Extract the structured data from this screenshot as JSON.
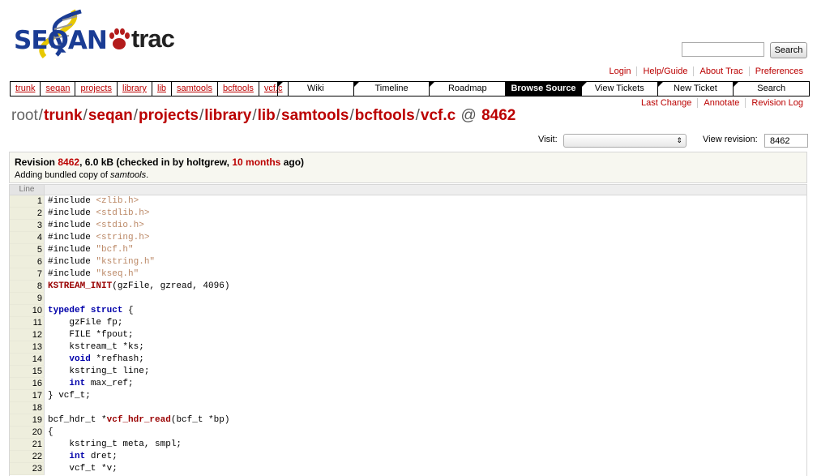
{
  "logo": {
    "left": "SEQAN",
    "right": "trac"
  },
  "search": {
    "placeholder": "",
    "button": "Search"
  },
  "metanav": [
    "Login",
    "Help/Guide",
    "About Trac",
    "Preferences"
  ],
  "pathnav": [
    "trunk",
    "seqan",
    "projects",
    "library",
    "lib",
    "samtools",
    "bcftools",
    "vcf.c"
  ],
  "mainnav": [
    "Wiki",
    "Timeline",
    "Roadmap",
    "Browse Source",
    "View Tickets",
    "New Ticket",
    "Search"
  ],
  "mainnav_active": "Browse Source",
  "ctxtnav": [
    "Last Change",
    "Annotate",
    "Revision Log"
  ],
  "path_title": {
    "root": "root",
    "segments": [
      "trunk",
      "seqan",
      "projects",
      "library",
      "lib",
      "samtools",
      "bcftools",
      "vcf.c"
    ],
    "at": "@",
    "revision": "8462"
  },
  "visit": {
    "label": "Visit:",
    "value": ""
  },
  "view_revision": {
    "label": "View revision:",
    "value": "8462"
  },
  "info": {
    "revision_prefix": "Revision ",
    "revision": "8462",
    "size_and_author": ", 6.0 kB (checked in by holtgrew, ",
    "age": "10 months",
    "suffix": " ago)",
    "message_prefix": "Adding bundled copy of ",
    "message_em": "samtools",
    "message_suffix": "."
  },
  "code": {
    "header": "Line",
    "lines": [
      [
        {
          "t": "#include ",
          "c": "pp"
        },
        {
          "t": "<zlib.h>",
          "c": "str"
        }
      ],
      [
        {
          "t": "#include ",
          "c": "pp"
        },
        {
          "t": "<stdlib.h>",
          "c": "str"
        }
      ],
      [
        {
          "t": "#include ",
          "c": "pp"
        },
        {
          "t": "<stdio.h>",
          "c": "str"
        }
      ],
      [
        {
          "t": "#include ",
          "c": "pp"
        },
        {
          "t": "<string.h>",
          "c": "str"
        }
      ],
      [
        {
          "t": "#include ",
          "c": "pp"
        },
        {
          "t": "\"bcf.h\"",
          "c": "str"
        }
      ],
      [
        {
          "t": "#include ",
          "c": "pp"
        },
        {
          "t": "\"kstring.h\"",
          "c": "str"
        }
      ],
      [
        {
          "t": "#include ",
          "c": "pp"
        },
        {
          "t": "\"kseq.h\"",
          "c": "str"
        }
      ],
      [
        {
          "t": "KSTREAM_INIT",
          "c": "fn"
        },
        {
          "t": "(gzFile, gzread, 4096)",
          "c": ""
        }
      ],
      [],
      [
        {
          "t": "typedef",
          "c": "kw"
        },
        {
          "t": " ",
          "c": ""
        },
        {
          "t": "struct",
          "c": "kw"
        },
        {
          "t": " {",
          "c": ""
        }
      ],
      [
        {
          "t": "    gzFile fp;",
          "c": ""
        }
      ],
      [
        {
          "t": "    FILE *fpout;",
          "c": ""
        }
      ],
      [
        {
          "t": "    kstream_t *ks;",
          "c": ""
        }
      ],
      [
        {
          "t": "    ",
          "c": ""
        },
        {
          "t": "void",
          "c": "ty"
        },
        {
          "t": " *refhash;",
          "c": ""
        }
      ],
      [
        {
          "t": "    kstring_t line;",
          "c": ""
        }
      ],
      [
        {
          "t": "    ",
          "c": ""
        },
        {
          "t": "int",
          "c": "ty"
        },
        {
          "t": " max_ref;",
          "c": ""
        }
      ],
      [
        {
          "t": "} vcf_t;",
          "c": ""
        }
      ],
      [],
      [
        {
          "t": "bcf_hdr_t *",
          "c": ""
        },
        {
          "t": "vcf_hdr_read",
          "c": "fn"
        },
        {
          "t": "(bcf_t *bp)",
          "c": ""
        }
      ],
      [
        {
          "t": "{",
          "c": ""
        }
      ],
      [
        {
          "t": "    kstring_t meta, smpl;",
          "c": ""
        }
      ],
      [
        {
          "t": "    ",
          "c": ""
        },
        {
          "t": "int",
          "c": "ty"
        },
        {
          "t": " dret;",
          "c": ""
        }
      ],
      [
        {
          "t": "    vcf_t *v;",
          "c": ""
        }
      ]
    ]
  },
  "colors": {
    "link": "#bb0000",
    "accent": "#000000",
    "line_bg": "#eeeedd"
  }
}
